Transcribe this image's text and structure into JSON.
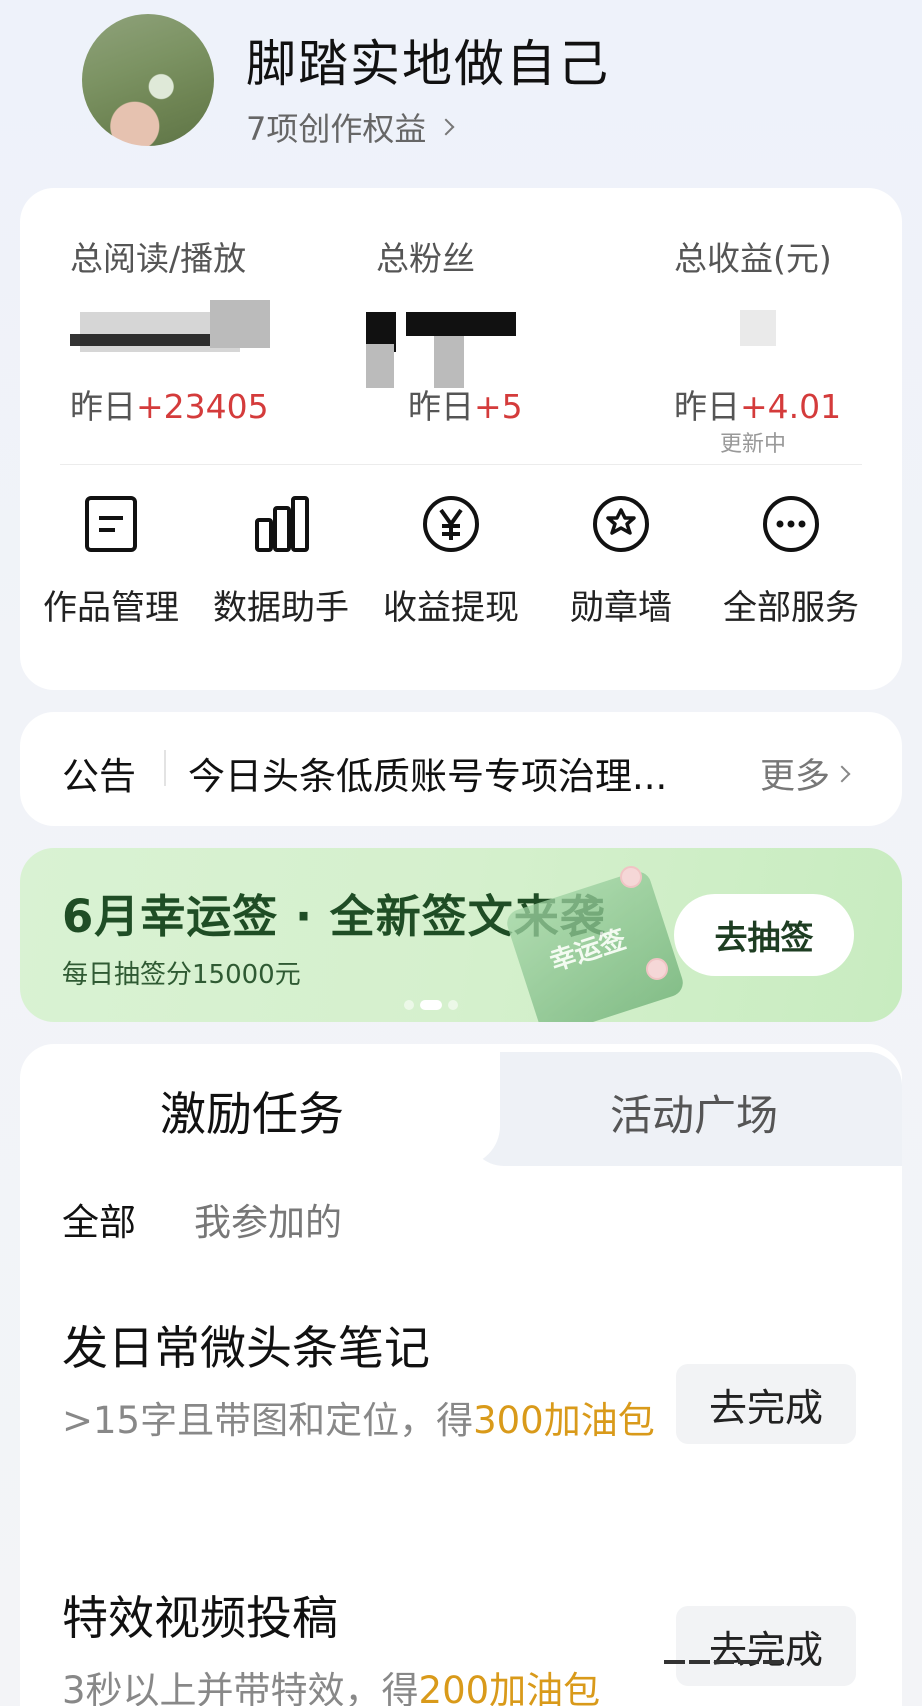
{
  "profile": {
    "name": "脚踏实地做自己",
    "rights_link": "7项创作权益"
  },
  "stats": [
    {
      "label": "总阅读/播放",
      "yesterday_prefix": "昨日",
      "yesterday_delta": "+23405"
    },
    {
      "label": "总粉丝",
      "yesterday_prefix": "昨日",
      "yesterday_delta": "+5"
    },
    {
      "label": "总收益(元)",
      "yesterday_prefix": "昨日",
      "yesterday_delta": "+4.01",
      "status": "更新中"
    }
  ],
  "services": [
    {
      "label": "作品管理",
      "icon": "document-icon"
    },
    {
      "label": "数据助手",
      "icon": "bar-chart-icon"
    },
    {
      "label": "收益提现",
      "icon": "yuan-icon"
    },
    {
      "label": "勋章墙",
      "icon": "medal-icon"
    },
    {
      "label": "全部服务",
      "icon": "more-icon"
    }
  ],
  "notice": {
    "tag": "公告",
    "text": "今日头条低质账号专项治理...",
    "more": "更多"
  },
  "banner": {
    "title": "6月幸运签 · 全新签文来袭",
    "subtitle": "每日抽签分15000元",
    "art_text": "幸运签",
    "button": "去抽签"
  },
  "tasks": {
    "tabs": [
      "激励任务",
      "活动广场"
    ],
    "filters": [
      "全部",
      "我参加的"
    ],
    "items": [
      {
        "title": "发日常微头条笔记",
        "desc": ">15字且带图和定位，得",
        "reward": "300加油包",
        "button": "去完成"
      },
      {
        "title": "特效视频投稿",
        "desc": "3秒以上并带特效，得",
        "reward": "200加油包",
        "button": "去完成"
      }
    ]
  },
  "colors": {
    "accent_red": "#d43b3b",
    "reward_gold": "#d99a1a",
    "banner_green": "#1f4d25"
  }
}
